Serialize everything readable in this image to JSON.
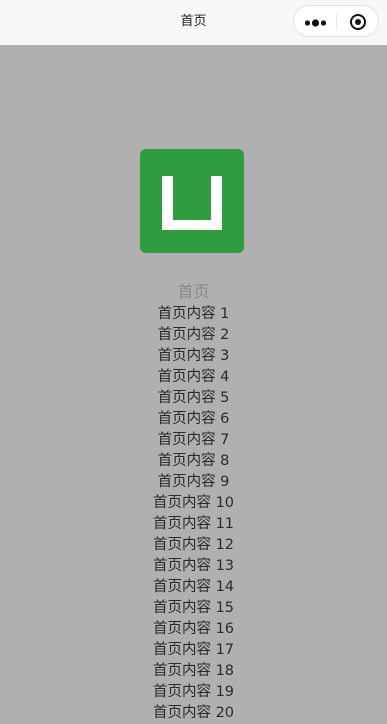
{
  "navbar": {
    "title": "首页",
    "capsule": {
      "more_icon": "more-dots-icon",
      "close_icon": "target-close-icon"
    }
  },
  "main": {
    "logo_icon": "app-logo-icon",
    "logo_color": "#2e9c3f",
    "heading": "首页",
    "items": [
      "首页内容 1",
      "首页内容 2",
      "首页内容 3",
      "首页内容 4",
      "首页内容 5",
      "首页内容 6",
      "首页内容 7",
      "首页内容 8",
      "首页内容 9",
      "首页内容 10",
      "首页内容 11",
      "首页内容 12",
      "首页内容 13",
      "首页内容 14",
      "首页内容 15",
      "首页内容 16",
      "首页内容 17",
      "首页内容 18",
      "首页内容 19",
      "首页内容 20"
    ]
  },
  "colors": {
    "background": "#b0b0b0",
    "navbar": "#f7f7f7"
  }
}
